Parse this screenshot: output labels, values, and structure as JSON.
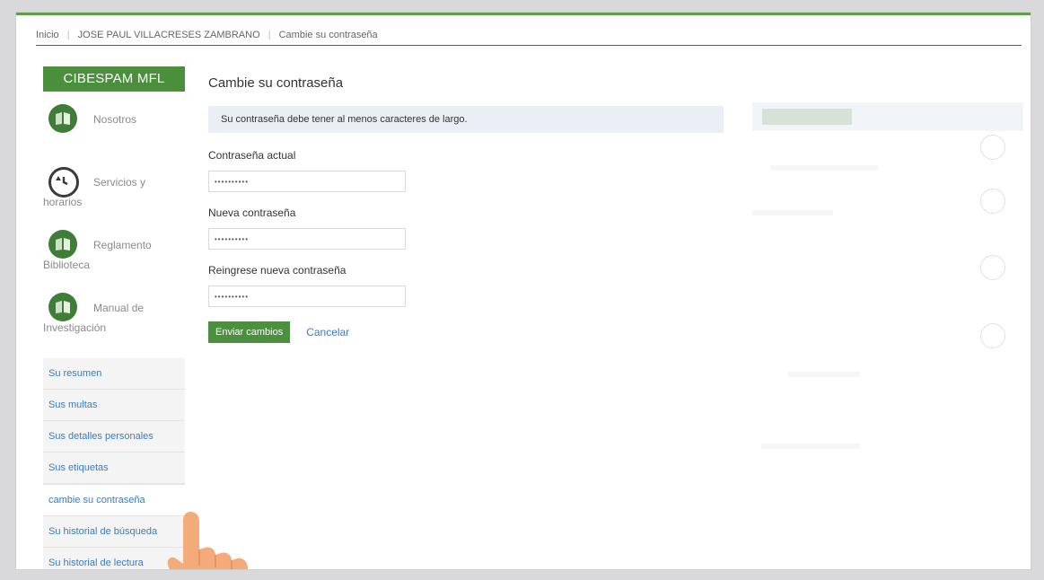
{
  "breadcrumb": [
    "Inicio",
    "JOSE PAUL VILLACRESES ZAMBRANO",
    "Cambie su contraseña"
  ],
  "sidebar": {
    "brand": "CIBESPAM MFL",
    "links": [
      {
        "line1": "Nosotros",
        "line2": "",
        "icon": "book-icon"
      },
      {
        "line1": "Servicios y",
        "line2": "horarios",
        "icon": "history-icon"
      },
      {
        "line1": "Reglamento",
        "line2": "Biblioteca",
        "icon": "book-icon"
      },
      {
        "line1": "Manual de",
        "line2": "Investigación",
        "icon": "book-icon"
      }
    ],
    "menu": [
      "Su resumen",
      "Sus multas",
      "Sus detalles personales",
      "Sus etiquetas",
      "cambie su contraseña",
      "Su historial de búsqueda",
      "Su historial de lectura"
    ]
  },
  "main": {
    "title": "Cambie su contraseña",
    "alert": "Su contraseña debe tener al menos caracteres de largo.",
    "fields": [
      {
        "label": "Contraseña actual",
        "value": "••••••••••"
      },
      {
        "label": "Nueva contraseña",
        "value": "••••••••••"
      },
      {
        "label": "Reingrese nueva contraseña",
        "value": "••••••••••"
      }
    ],
    "submit_label": "Enviar cambios",
    "cancel_label": "Cancelar"
  },
  "colors": {
    "brand_green": "#4a8f3b",
    "link_blue": "#3c7bbd",
    "alert_bg": "#e9eff4"
  }
}
